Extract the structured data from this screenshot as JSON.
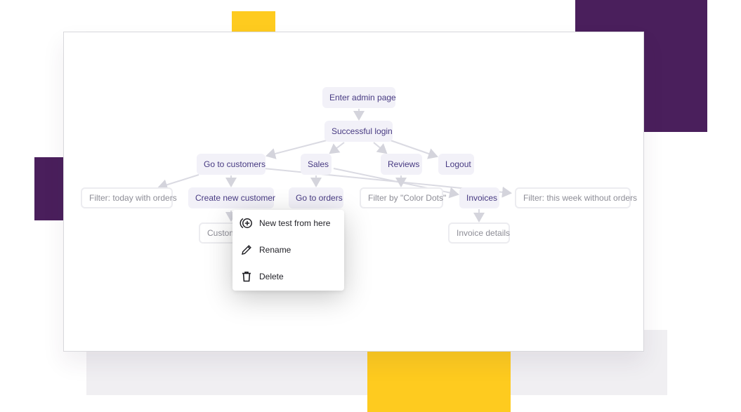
{
  "flow": {
    "nodes": {
      "enter_admin": "Enter admin page",
      "successful_login": "Successful login",
      "go_to_customers": "Go to customers",
      "sales": "Sales",
      "reviews": "Reviews",
      "logout": "Logout",
      "filter_today": "Filter: today with orders",
      "create_customer": "Create new customer",
      "go_to_orders": "Go to orders",
      "filter_color_dots": "Filter by \"Color Dots\"",
      "invoices": "Invoices",
      "filter_week": "Filter: this week without orders",
      "customer_partial": "Custom",
      "invoice_details": "Invoice details"
    }
  },
  "context_menu": {
    "items": [
      {
        "label": "New test from here",
        "icon": "plus-circle-icon"
      },
      {
        "label": "Rename",
        "icon": "pencil-icon"
      },
      {
        "label": "Delete",
        "icon": "trash-icon"
      }
    ]
  },
  "colors": {
    "brand_purple": "#4a1f5c",
    "brand_yellow": "#fecb1f",
    "node_fill": "#f2f1f8",
    "node_text": "#473a82"
  }
}
